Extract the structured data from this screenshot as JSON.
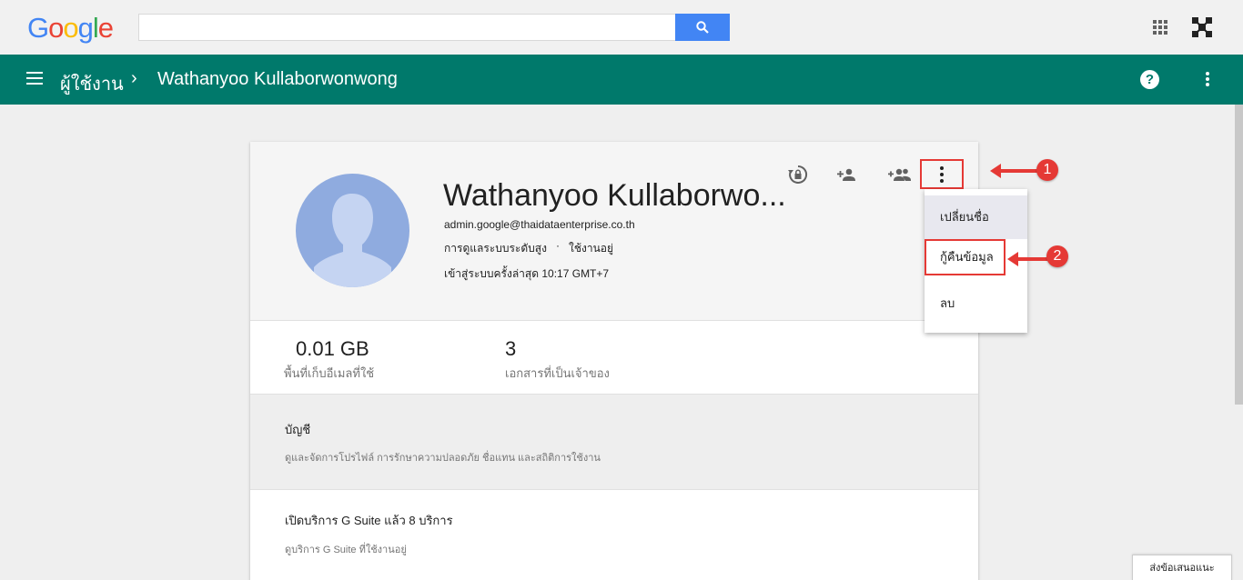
{
  "header": {
    "logo_letters": [
      {
        "ch": "G",
        "color": "#4285f4"
      },
      {
        "ch": "o",
        "color": "#ea4335"
      },
      {
        "ch": "o",
        "color": "#fbbc05"
      },
      {
        "ch": "g",
        "color": "#4285f4"
      },
      {
        "ch": "l",
        "color": "#34a853"
      },
      {
        "ch": "e",
        "color": "#ea4335"
      }
    ],
    "search_value": "",
    "search_icon": "search-icon",
    "apps_icon": "apps-grid-icon"
  },
  "appbar": {
    "breadcrumb_parent": "ผู้ใช้งาน",
    "breadcrumb_separator": "›",
    "breadcrumb_current": "Wathanyoo Kullaborwonwong",
    "help_glyph": "?",
    "color": "#00796b"
  },
  "profile": {
    "name": "Wathanyoo Kullaborwo...",
    "email": "admin.google@thaidataenterprise.co.th",
    "role": "การดูแลระบบระดับสูง",
    "separator": "·",
    "status": "ใช้งานอยู่",
    "last_login": "เข้าสู่ระบบครั้งล่าสุด 10:17 GMT+7"
  },
  "stats": [
    {
      "value": "0.01 GB",
      "label": "พื้นที่เก็บอีเมลที่ใช้"
    },
    {
      "value": "3",
      "label": "เอกสารที่เป็นเจ้าของ"
    }
  ],
  "sections": [
    {
      "title": "บัญชี",
      "desc": "ดูและจัดการโปรไฟล์ การรักษาความปลอดภัย ชื่อแทน และสถิติการใช้งาน"
    },
    {
      "title": "เปิดบริการ G Suite แล้ว 8 บริการ",
      "desc": "ดูบริการ G Suite ที่ใช้งานอยู่"
    }
  ],
  "dropdown": {
    "items": [
      "เปลี่ยนชื่อ",
      "กู้คืนข้อมูล",
      "ลบ"
    ]
  },
  "annotations": [
    "1",
    "2"
  ],
  "feedback_label": "ส่งข้อเสนอแนะ"
}
